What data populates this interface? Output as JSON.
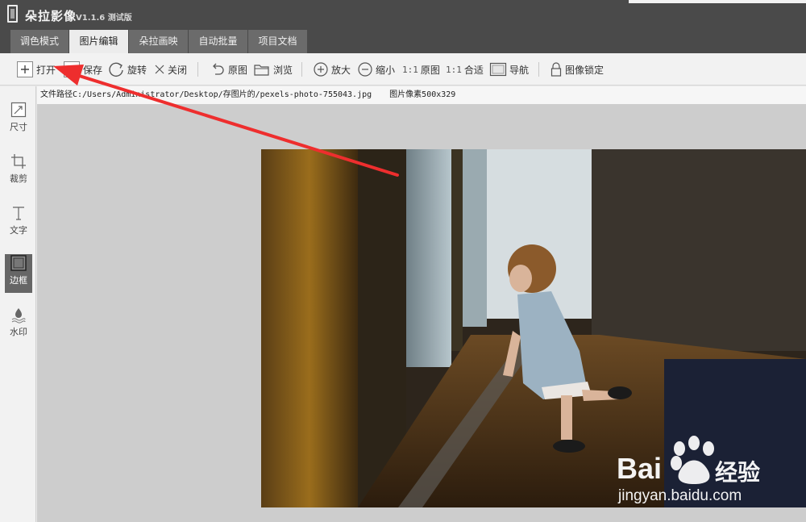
{
  "title_bar": {
    "app_name": "朵拉影像",
    "version": "V1.1.6 测试版"
  },
  "tabs": [
    {
      "label": "调色模式",
      "active": false
    },
    {
      "label": "图片编辑",
      "active": true
    },
    {
      "label": "朵拉画映",
      "active": false
    },
    {
      "label": "自动批量",
      "active": false
    },
    {
      "label": "项目文档",
      "active": false
    }
  ],
  "toolbar": {
    "open": "打开",
    "save": "保存",
    "rotate": "旋转",
    "close": "关闭",
    "original": "原图",
    "browse": "浏览",
    "zoom_in": "放大",
    "zoom_out": "缩小",
    "actual_size_prefix": "1:1",
    "actual_size": "原图",
    "fit_prefix": "1:1",
    "fit": "合适",
    "navigate": "导航",
    "lock": "图像锁定"
  },
  "left_tools": [
    {
      "label": "尺寸",
      "icon": "resize-icon",
      "active": false
    },
    {
      "label": "裁剪",
      "icon": "crop-icon",
      "active": false
    },
    {
      "label": "文字",
      "icon": "text-icon",
      "active": false
    },
    {
      "label": "边框",
      "icon": "border-icon",
      "active": true
    },
    {
      "label": "水印",
      "icon": "watermark-drop-icon",
      "active": false
    }
  ],
  "info": {
    "path": "文件路径C:/Users/Administrator/Desktop/存图片的/pexels-photo-755043.jpg",
    "pixels": "图片像素500x329"
  },
  "watermark": {
    "brand_left": "Bai",
    "brand_right": "经验",
    "url": "jingyan.baidu.com"
  },
  "colors": {
    "arrow": "#ee2e2e",
    "title_bg": "#4a4a4a",
    "active_tool": "#666666"
  }
}
